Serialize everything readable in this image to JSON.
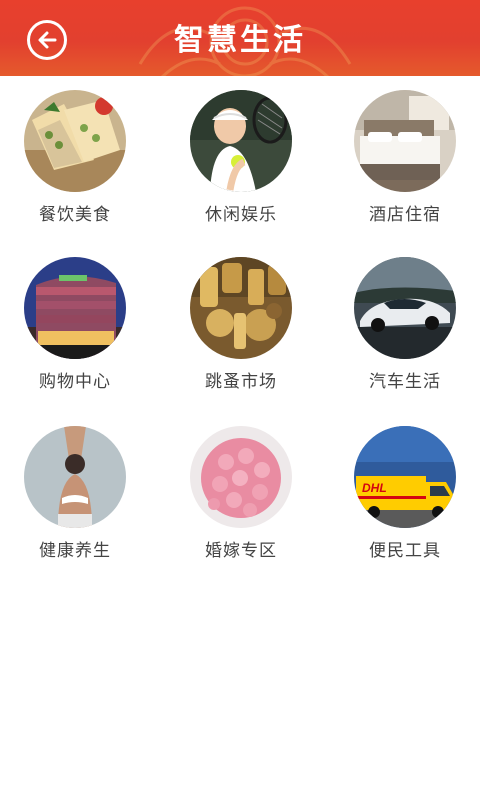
{
  "header": {
    "title": "智慧生活",
    "back_icon": "back-arrow-icon",
    "bg_color": "#e2402f"
  },
  "categories": [
    {
      "label": "餐饮美食",
      "icon": "food-thumbnail"
    },
    {
      "label": "休闲娱乐",
      "icon": "tennis-thumbnail"
    },
    {
      "label": "酒店住宿",
      "icon": "hotel-thumbnail"
    },
    {
      "label": "购物中心",
      "icon": "mall-thumbnail"
    },
    {
      "label": "跳蚤市场",
      "icon": "market-thumbnail"
    },
    {
      "label": "汽车生活",
      "icon": "car-thumbnail"
    },
    {
      "label": "健康养生",
      "icon": "yoga-thumbnail"
    },
    {
      "label": "婚嫁专区",
      "icon": "wedding-thumbnail"
    },
    {
      "label": "便民工具",
      "icon": "truck-thumbnail"
    }
  ],
  "truck_brand": "DHL"
}
